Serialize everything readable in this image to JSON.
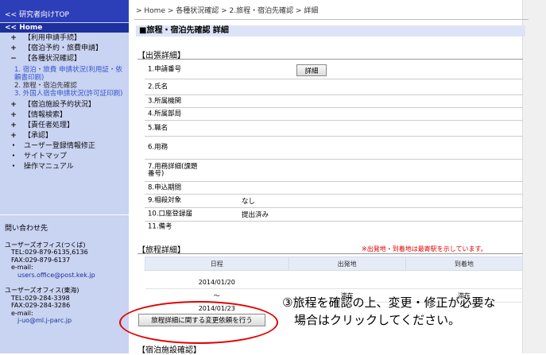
{
  "sidebar": {
    "top_link": "<< 研究者向けTOP",
    "home_link": "<< Home",
    "items": [
      {
        "mark": "+",
        "label": "【利用申請手続】"
      },
      {
        "mark": "+",
        "label": "【宿泊予約・旅費申請】"
      },
      {
        "mark": "−",
        "label": "【各種状況確認】"
      }
    ],
    "sub_items": [
      {
        "label": "1. 宿泊・旅費 申請状況(利用証・依頼書印刷)"
      },
      {
        "label": "2. 旅程・宿泊先確認"
      },
      {
        "label": "3. 外国人宿舎申請状況(許可証印刷)"
      }
    ],
    "items2": [
      {
        "mark": "+",
        "label": "【宿泊施設予約状況】"
      },
      {
        "mark": "+",
        "label": "【情報検索】"
      },
      {
        "mark": "+",
        "label": "【責任者処理】"
      },
      {
        "mark": "+",
        "label": "【承認】"
      },
      {
        "mark": "・",
        "label": "ユーザー登録情報修正"
      },
      {
        "mark": "・",
        "label": "サイトマップ"
      },
      {
        "mark": "・",
        "label": "操作マニュアル"
      }
    ],
    "contact": {
      "title": "問い合わせ先",
      "offices": [
        {
          "name": "ユーザーズオフィス(つくば)",
          "tel": "TEL:029-879-6135,6136",
          "fax": "FAX:029-879-6137",
          "email_label": "e-mail:",
          "email": "users.office@post.kek.jp"
        },
        {
          "name": "ユーザーズオフィス(東海)",
          "tel": "TEL:029-284-3398",
          "fax": "FAX:029-284-3286",
          "email_label": "e-mail:",
          "email": "j-uo@ml.j-parc.jp"
        }
      ]
    }
  },
  "breadcrumb": "> Home > 各種状況確認 > 2.旅程・宿泊先確認 > 詳細",
  "page_title": "■旅程・宿泊先確認 詳細",
  "trip_section": {
    "title": "【出張詳細】",
    "detail_button": "詳細",
    "fields": [
      {
        "label": "1.申請番号",
        "value": ""
      },
      {
        "label": "2.氏名",
        "value": ""
      },
      {
        "label": "3.所属機関",
        "value": ""
      },
      {
        "label": "4.所属部局",
        "value": ""
      },
      {
        "label": "5.職名",
        "value": ""
      },
      {
        "label": "6.用務",
        "value": ""
      },
      {
        "label": "7.用務詳細(課題番号)",
        "value": ""
      },
      {
        "label": "8.申込期間",
        "value": ""
      },
      {
        "label": "9.相殺対象",
        "value": "なし"
      },
      {
        "label": "10.口座登録届",
        "value": "提出済み"
      },
      {
        "label": "11.備考",
        "value": ""
      }
    ]
  },
  "itinerary": {
    "title": "【旅程詳細】",
    "note": "※出発地・到着地は最寄駅を示しています。",
    "headers": {
      "date": "日程",
      "from": "出発地",
      "to": "到着地"
    },
    "rows": [
      {
        "date": "2014/01/20",
        "from": "",
        "to": ""
      },
      {
        "date": "〜",
        "from": "滞在",
        "to": "滞在"
      },
      {
        "date": "2014/01/23",
        "from": "",
        "to": ""
      }
    ],
    "change_button": "旅程詳細に関する変更依頼を行う"
  },
  "facility_section": {
    "title": "【宿泊施設確認】"
  },
  "callout": {
    "number": "③",
    "line1": "旅程を確認の上、変更・修正が必要な",
    "line2": "場合はクリックしてください。"
  },
  "colors": {
    "sidebar_bg": "#c9d3f2",
    "top_bar": "#2d3fb8",
    "note_red": "#e00000",
    "circle_red": "#e20000"
  }
}
